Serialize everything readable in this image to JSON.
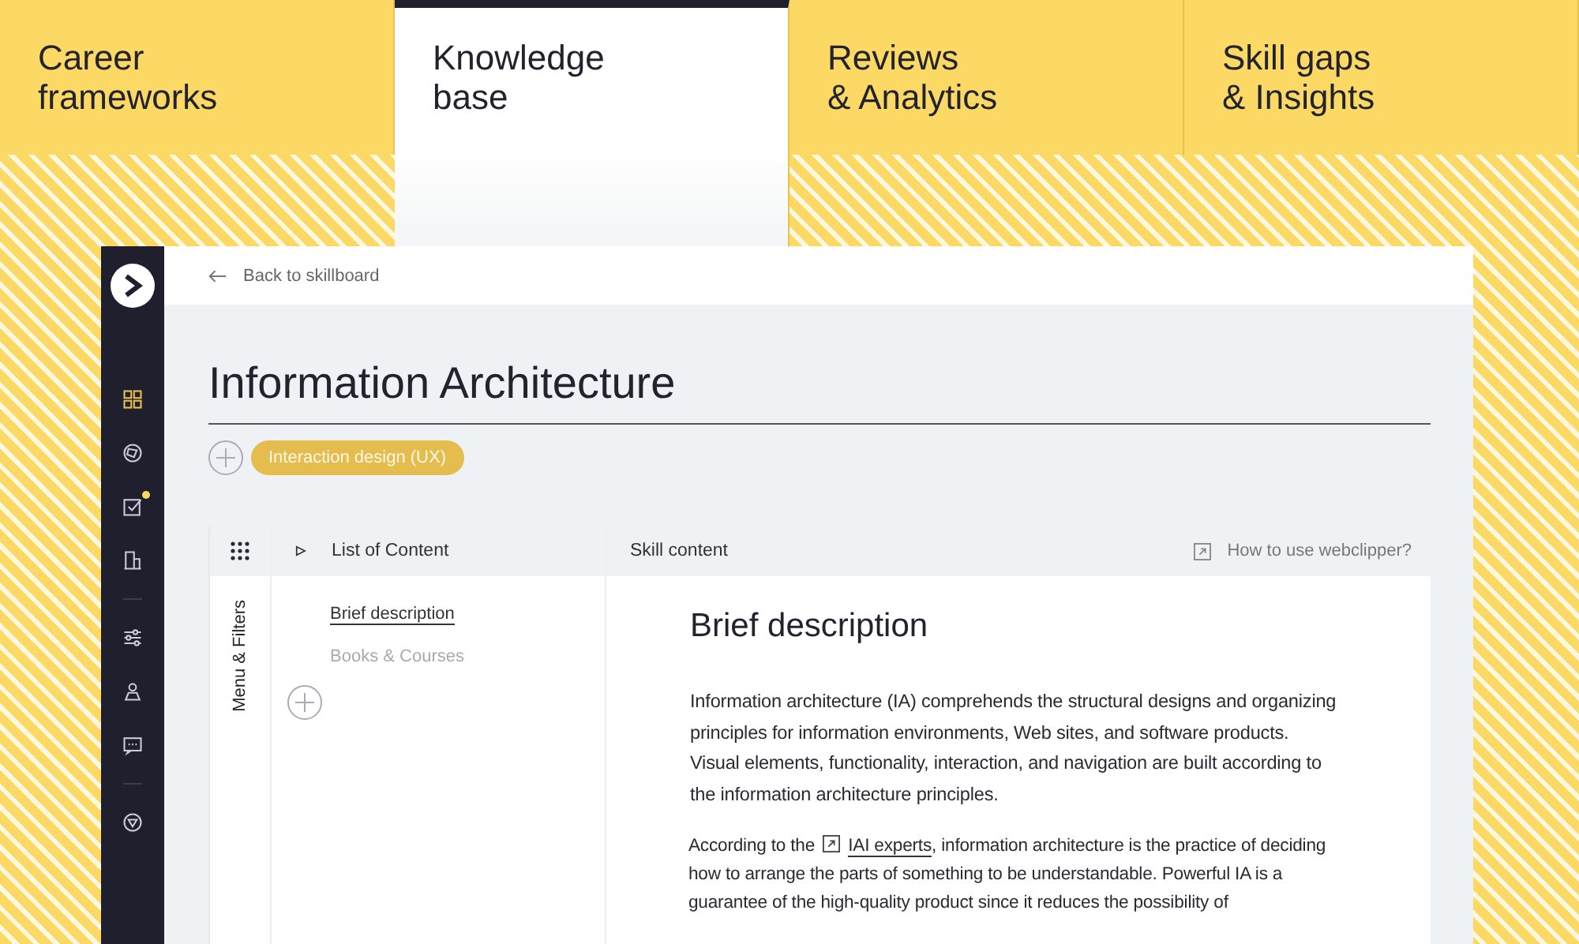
{
  "tabs": [
    {
      "lines": [
        "Career",
        "frameworks"
      ],
      "selected": false
    },
    {
      "lines": [
        "Knowledge",
        "base"
      ],
      "selected": true
    },
    {
      "lines": [
        "Reviews",
        "& Analytics"
      ],
      "selected": false
    },
    {
      "lines": [
        "Skill gaps",
        "& Insights"
      ],
      "selected": false
    }
  ],
  "sidebar": {
    "groups": [
      [
        {
          "selected": true,
          "badge": false
        },
        {
          "selected": false,
          "badge": false
        },
        {
          "selected": false,
          "badge": true
        },
        {
          "selected": false,
          "badge": false
        }
      ],
      [
        {
          "selected": false,
          "badge": false
        },
        {
          "selected": false,
          "badge": false
        },
        {
          "selected": false,
          "badge": false
        }
      ],
      [
        {
          "selected": false,
          "badge": false
        }
      ]
    ]
  },
  "back_link": "Back to skillboard",
  "page_title": "Information Architecture",
  "tags": [
    "Interaction design (UX)"
  ],
  "panel": {
    "side_label": "Menu & Filters",
    "list_header": "List of Content",
    "content_header": "Skill content",
    "help_link": "How to use webclipper?",
    "contents": [
      {
        "label": "Brief description",
        "selected": true
      },
      {
        "label": "Books & Courses",
        "selected": false
      }
    ]
  },
  "article": {
    "heading": "Brief description",
    "paragraph_1": "Information architecture (IA) comprehends the structural designs and organizing principles for information environments, Web sites, and software products. Visual elements, functionality, interaction, and navigation are built according to the information architecture principles.",
    "paragraph_2": {
      "before": "According to the",
      "link": "IAI experts",
      "after": ", information architecture is the practice of deciding how to arrange the parts of something to be understandable. Powerful IA is a guarantee of the high-quality product since it reduces the possibility of"
    }
  }
}
